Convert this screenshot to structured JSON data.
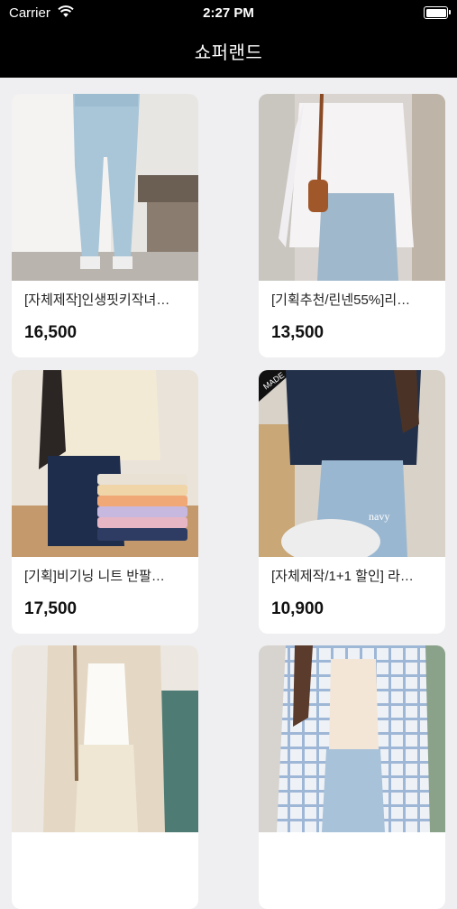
{
  "status_bar": {
    "carrier": "Carrier",
    "time": "2:27 PM"
  },
  "header": {
    "title": "쇼퍼랜드"
  },
  "products": [
    {
      "name": "[자체제작]인생핏키작녀…",
      "price": "16,500",
      "image": "light-wash-jeans-photo"
    },
    {
      "name": "[기획추천/린넨55%]리…",
      "price": "13,500",
      "image": "white-linen-cardigan-photo"
    },
    {
      "name": "[기획]비기닝 니트 반팔…",
      "price": "17,500",
      "image": "knit-short-sleeve-stack-photo"
    },
    {
      "name": "[자체제작/1+1 할인] 라…",
      "price": "10,900",
      "image": "navy-tshirt-photo",
      "image_badge": "navy",
      "corner_badge": "MADE"
    },
    {
      "name": "",
      "price": "",
      "image": "beige-cardigan-photo"
    },
    {
      "name": "",
      "price": "",
      "image": "check-shirt-photo"
    }
  ]
}
